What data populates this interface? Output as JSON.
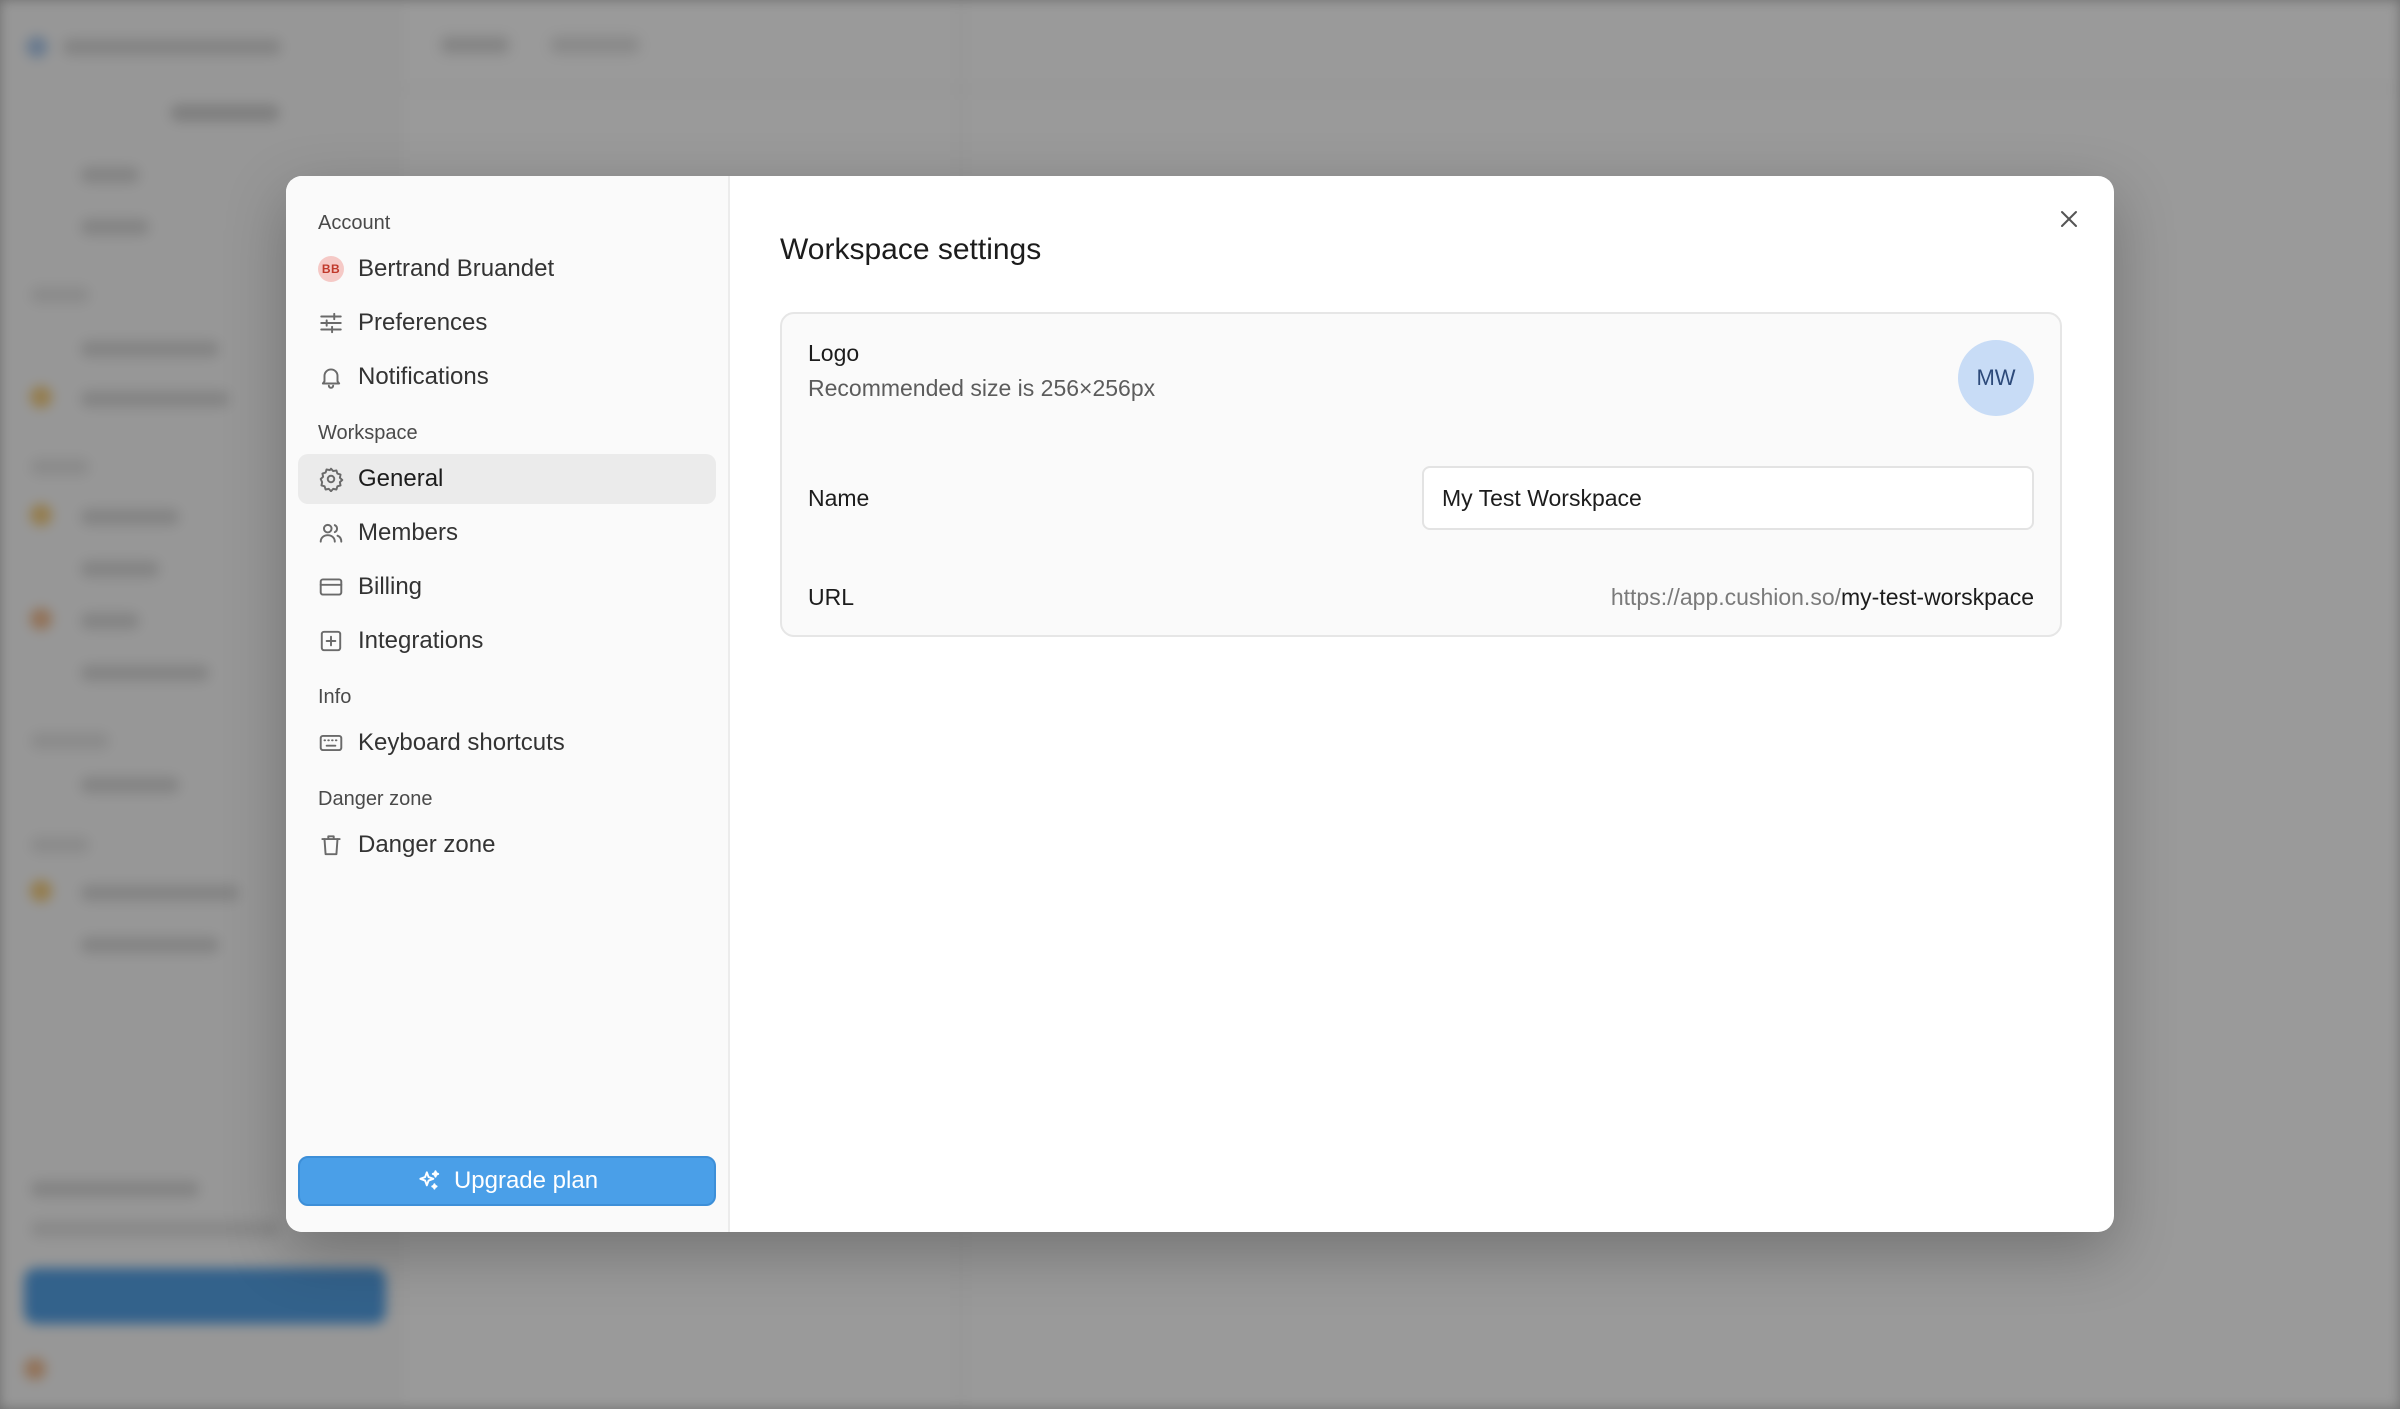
{
  "modal": {
    "title": "Workspace settings",
    "close_icon": "close-icon"
  },
  "nav": {
    "sections": {
      "account": "Account",
      "workspace": "Workspace",
      "info": "Info",
      "danger": "Danger zone"
    },
    "user": {
      "initials": "BB",
      "name": "Bertrand Bruandet"
    },
    "items": {
      "preferences": {
        "label": "Preferences",
        "icon": "sliders-icon"
      },
      "notifications": {
        "label": "Notifications",
        "icon": "bell-icon"
      },
      "general": {
        "label": "General",
        "icon": "gear-icon",
        "active": true
      },
      "members": {
        "label": "Members",
        "icon": "users-icon"
      },
      "billing": {
        "label": "Billing",
        "icon": "credit-card-icon"
      },
      "integrations": {
        "label": "Integrations",
        "icon": "plus-square-icon"
      },
      "shortcuts": {
        "label": "Keyboard shortcuts",
        "icon": "keyboard-icon"
      },
      "danger": {
        "label": "Danger zone",
        "icon": "trash-icon"
      }
    },
    "upgrade": {
      "label": "Upgrade plan",
      "icon": "sparkles-icon"
    }
  },
  "settings": {
    "logo": {
      "label": "Logo",
      "hint": "Recommended size is 256×256px",
      "initials": "MW"
    },
    "name": {
      "label": "Name",
      "value": "My Test Worskpace"
    },
    "url": {
      "label": "URL",
      "prefix": "https://app.cushion.so/",
      "slug": "my-test-worskpace"
    }
  },
  "colors": {
    "accent": "#4a9fe8",
    "active_bg": "#ebebeb",
    "logo_avatar_bg": "#c8dcf6",
    "user_avatar_bg": "#f5c9c6"
  }
}
